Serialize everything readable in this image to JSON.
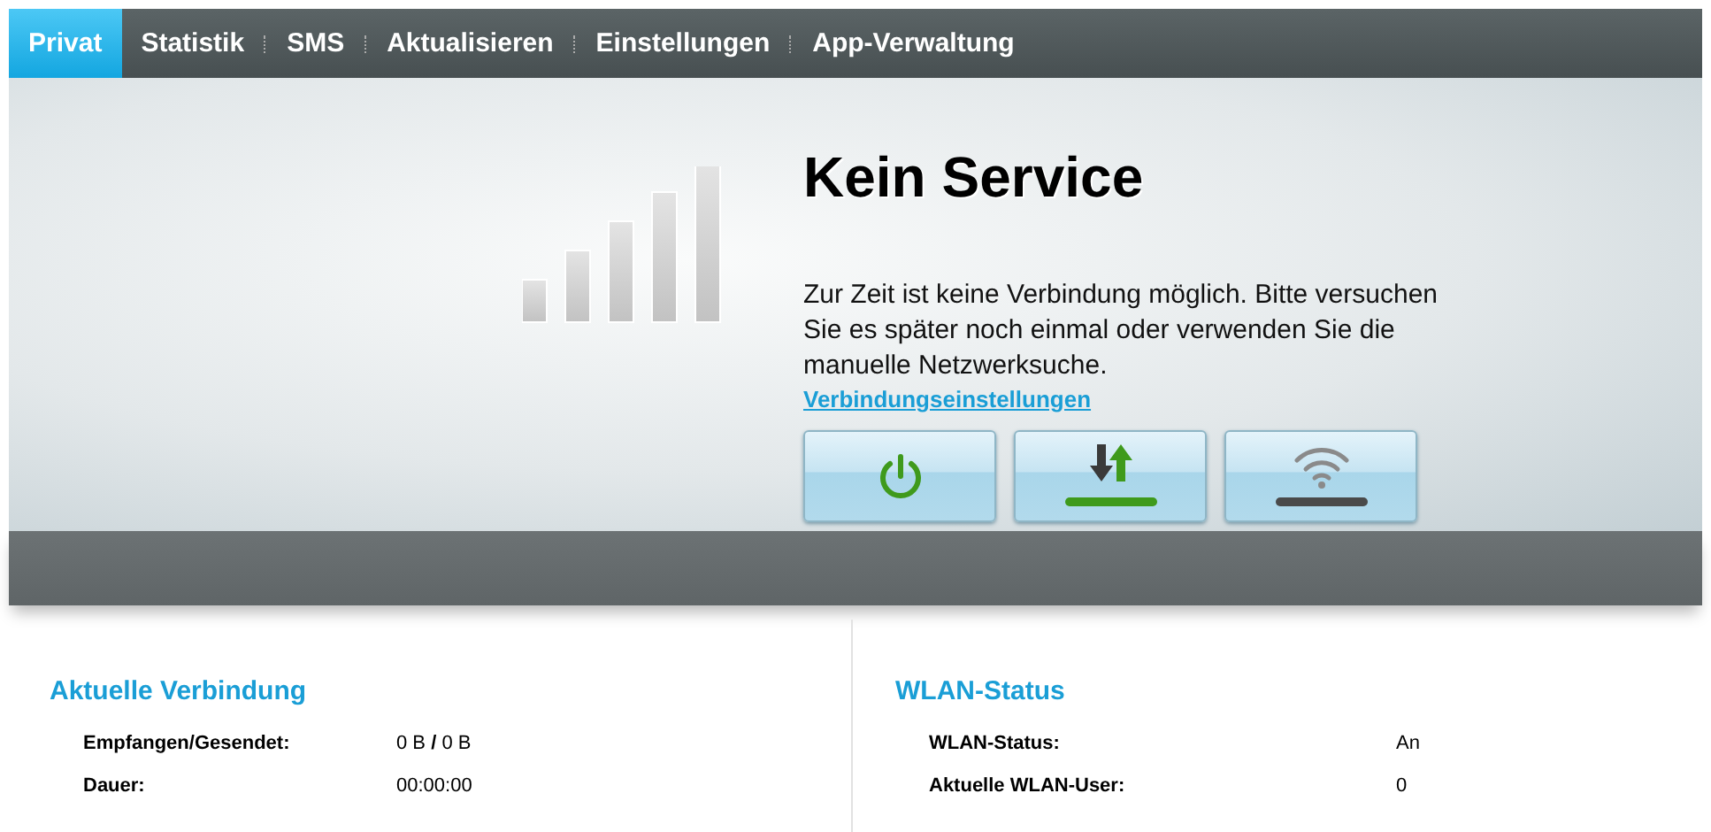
{
  "nav": [
    {
      "label": "Privat",
      "selected": true
    },
    {
      "label": "Statistik",
      "selected": false
    },
    {
      "label": "SMS",
      "selected": false
    },
    {
      "label": "Aktualisieren",
      "selected": false
    },
    {
      "label": "Einstellungen",
      "selected": false
    },
    {
      "label": "App-Verwaltung",
      "selected": false
    }
  ],
  "status": {
    "title": "Kein Service",
    "message": "Zur Zeit ist keine Verbindung möglich. Bitte versuchen Sie es später noch einmal oder verwenden Sie die manuelle Netzwerksuche.",
    "link": "Verbindungseinstellungen"
  },
  "controls": [
    {
      "kind": "power",
      "on": true
    },
    {
      "kind": "data",
      "on": true
    },
    {
      "kind": "wlan",
      "on": false
    }
  ],
  "panels": [
    {
      "title": "Aktuelle Verbindung",
      "rows": [
        {
          "label": "Empfangen/Gesendet:",
          "value": "0 B **/**  0 B"
        },
        {
          "label": "Dauer:",
          "value": "00:00:00"
        }
      ]
    },
    {
      "title": "WLAN-Status",
      "rows": [
        {
          "label": "WLAN-Status:",
          "value": "An"
        },
        {
          "label": "Aktuelle WLAN-User:",
          "value": "0"
        }
      ]
    }
  ]
}
